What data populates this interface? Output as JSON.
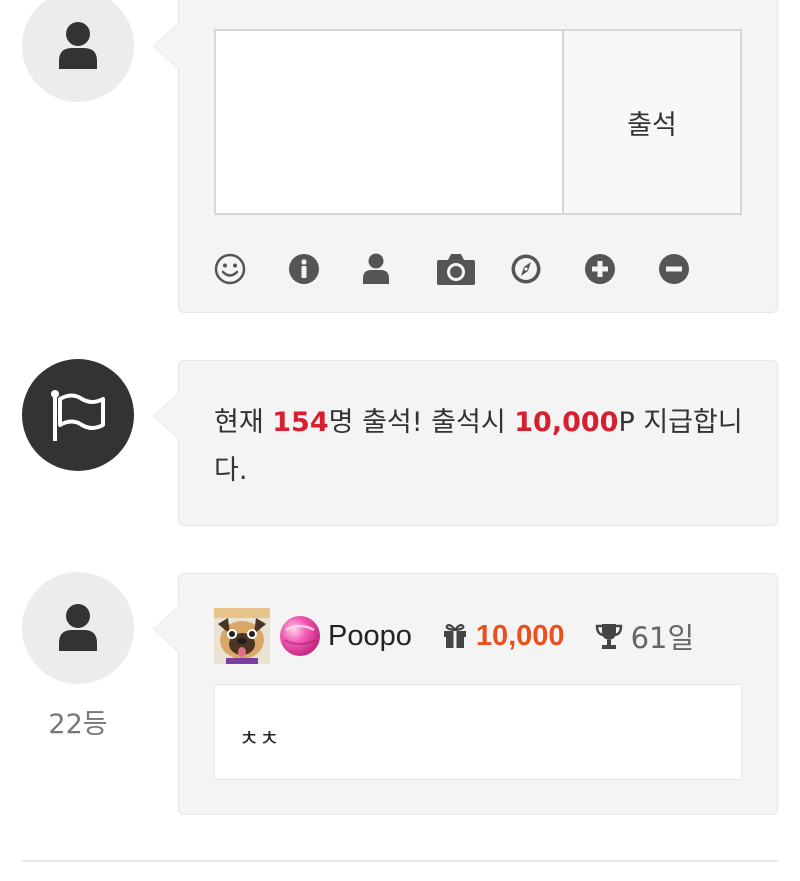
{
  "comment_form": {
    "textarea_value": "",
    "textarea_placeholder": "",
    "submit_label": "출석",
    "toolbar_icons": [
      "smile-icon",
      "info-icon",
      "user-icon",
      "camera-icon",
      "compass-icon",
      "plus-circle-icon",
      "minus-circle-icon"
    ]
  },
  "notice": {
    "prefix": "현재 ",
    "count": "154",
    "middle": "명 출석! 출석시 ",
    "points": "10,000",
    "suffix": "P 지급합니다."
  },
  "entry": {
    "nickname": "Poopo",
    "points": "10,000",
    "days": "61일",
    "message": "ㅊㅊ",
    "rank": "22등"
  },
  "colors": {
    "highlight_red": "#d7202f",
    "points_orange": "#e8501e",
    "bubble_bg": "#f4f4f4",
    "avatar_bg": "#ececec",
    "dark_avatar_bg": "#333333"
  }
}
